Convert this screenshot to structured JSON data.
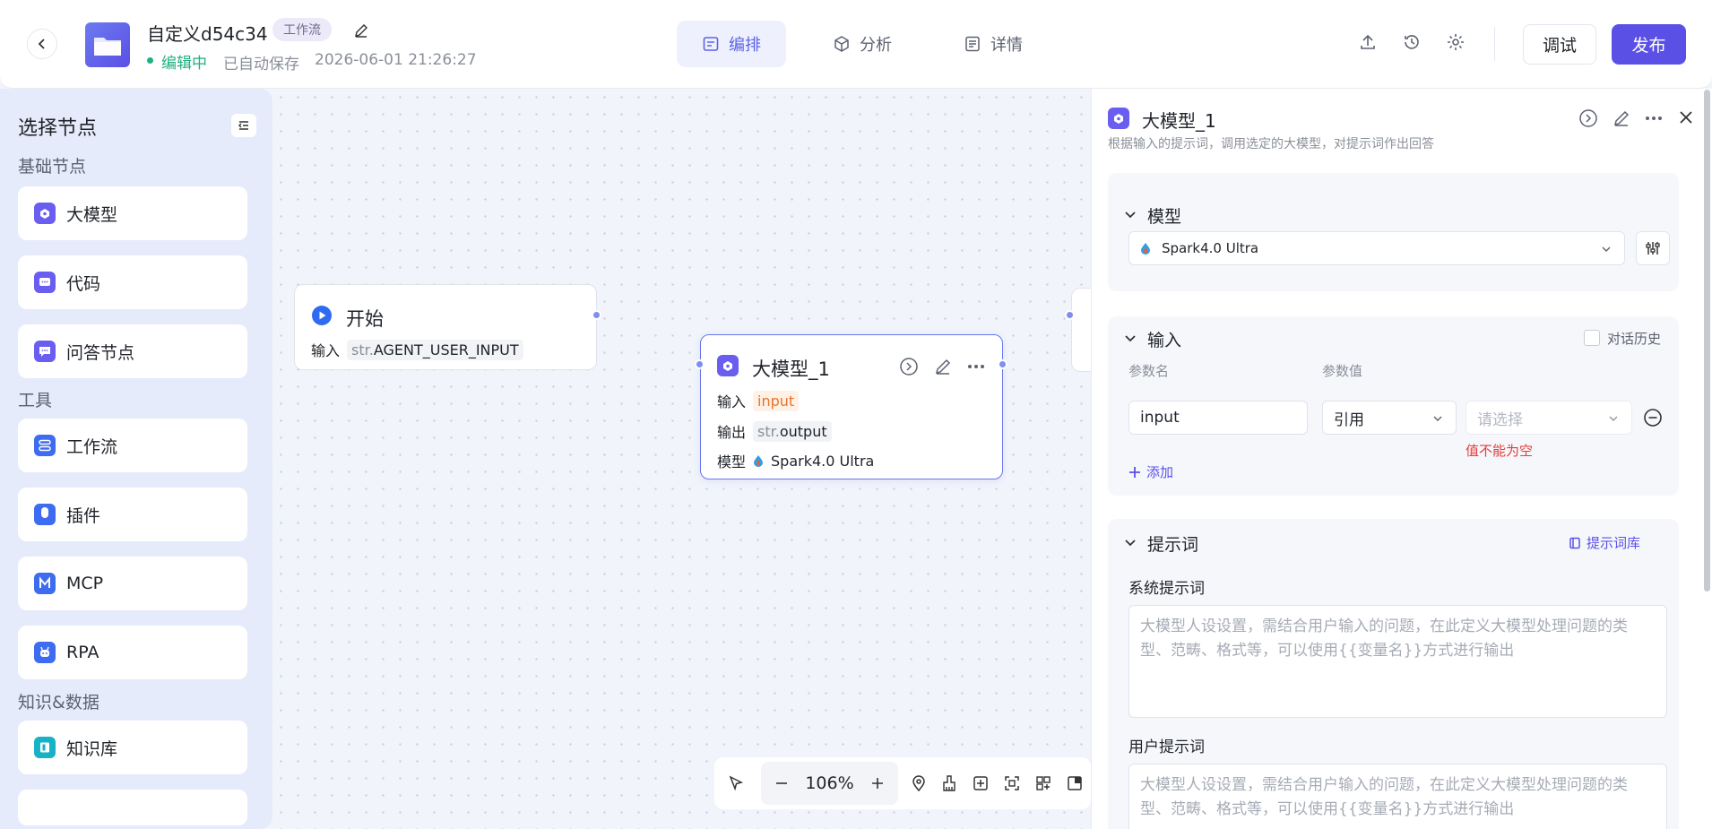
{
  "header": {
    "back_label": "back",
    "app_title": "自定义d54c34",
    "type_tag": "工作流",
    "status": "编辑中",
    "autosave": "已自动保存",
    "save_time": "2026-06-01 21:26:27",
    "tabs": [
      {
        "label": "编排",
        "icon": "layout-icon"
      },
      {
        "label": "分析",
        "icon": "cube-icon"
      },
      {
        "label": "详情",
        "icon": "document-icon"
      }
    ],
    "debug_label": "调试",
    "publish_label": "发布"
  },
  "sidebar": {
    "title": "选择节点",
    "groups": [
      {
        "label": "基础节点",
        "items": [
          "大模型",
          "代码",
          "问答节点"
        ]
      },
      {
        "label": "工具",
        "items": [
          "工作流",
          "插件",
          "MCP",
          "RPA"
        ]
      },
      {
        "label": "知识&数据",
        "items": [
          "知识库"
        ]
      }
    ]
  },
  "canvas": {
    "start_node": {
      "title": "开始",
      "input_label": "输入",
      "input_type": "str.",
      "input_value": "AGENT_USER_INPUT"
    },
    "llm_node": {
      "title": "大模型_1",
      "input_label": "输入",
      "input_value": "input",
      "output_label": "输出",
      "output_type": "str.",
      "output_value": "output",
      "model_label": "模型",
      "model_value": "Spark4.0 Ultra"
    },
    "zoom": "106%"
  },
  "panel": {
    "title": "大模型_1",
    "description": "根据输入的提示词，调用选定的大模型，对提示词作出回答",
    "model_section": {
      "label": "模型",
      "selected": "Spark4.0 Ultra"
    },
    "input_section": {
      "label": "输入",
      "history_label": "对话历史",
      "col_name": "参数名",
      "col_value": "参数值",
      "param_name": "input",
      "param_mode": "引用",
      "param_placeholder": "请选择",
      "error": "值不能为空",
      "add_label": "添加"
    },
    "prompt_section": {
      "label": "提示词",
      "library_label": "提示词库",
      "system_label": "系统提示词",
      "system_placeholder": "大模型人设设置，需结合用户输入的问题，在此定义大模型处理问题的类型、范畴、格式等，可以使用{{变量名}}方式进行输出",
      "user_label": "用户提示词",
      "user_placeholder": "大模型人设设置，需结合用户输入的问题，在此定义大模型处理问题的类型、范畴、格式等，可以使用{{变量名}}方式进行输出"
    }
  },
  "colors": {
    "accent": "#5b50e6",
    "status_green": "#22b07d",
    "error_red": "#e23c3c",
    "node_border": "#6877ea"
  }
}
